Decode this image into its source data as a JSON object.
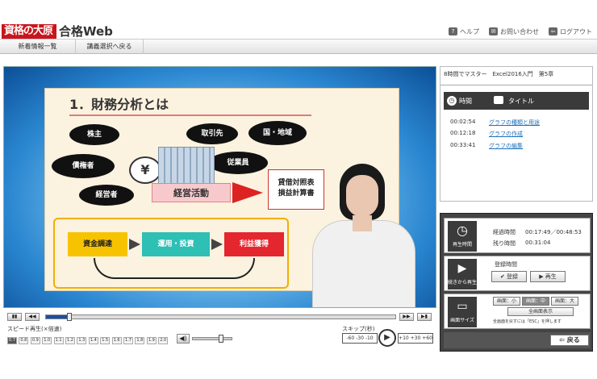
{
  "header": {
    "logo_primary": "資格の大原",
    "logo_secondary": "合格Web",
    "links": [
      {
        "icon": "help-icon",
        "label": "ヘルプ"
      },
      {
        "icon": "mail-icon",
        "label": "お問い合わせ"
      },
      {
        "icon": "logout-icon",
        "label": "ログアウト"
      }
    ]
  },
  "nav": {
    "items": [
      "新着情報一覧",
      "講義選択へ戻る"
    ]
  },
  "slide": {
    "title": "1．財務分析とは",
    "ovals": [
      "株主",
      "取引先",
      "国・地域",
      "債権者",
      "従業員",
      "経営者"
    ],
    "yen": "¥",
    "center": "経営活動",
    "doc": "貸借対照表\n損益計算書",
    "flow": [
      "資金調達",
      "運用・投資",
      "利益獲得"
    ]
  },
  "player": {
    "speed_label": "スピード再生(×倍速)",
    "speeds": [
      "0.7",
      "0.8",
      "0.9",
      "1.0",
      "1.1",
      "1.2",
      "1.3",
      "1.4",
      "1.5",
      "1.6",
      "1.7",
      "1.8",
      "1.9",
      "2.0"
    ],
    "skip_label": "スキップ(秒)",
    "skip_back": [
      "-60",
      "-30",
      "-10"
    ],
    "skip_fwd": [
      "+10",
      "+30",
      "+60"
    ],
    "progress": 0.06,
    "volume": 0.7
  },
  "course": {
    "title": "8時間でマスター　Excel2016入門　第5章",
    "col_time": "時間",
    "col_title": "タイトル",
    "chapters": [
      {
        "time": "00:02:54",
        "title": "グラフの種類と用途"
      },
      {
        "time": "00:12:18",
        "title": "グラフの作成"
      },
      {
        "time": "00:33:41",
        "title": "グラフの編集"
      }
    ]
  },
  "panel": {
    "play_time_label": "再生時間",
    "elapsed_label": "経過時間",
    "elapsed": "00:17:49／00:48:53",
    "remaining_label": "残り時間",
    "remaining": "00:31:04",
    "resume_label": "続きから再生",
    "register_label": "登録時間",
    "register_btn": "登録",
    "play_btn": "再生",
    "screen_label": "画面サイズ",
    "size_small": "画面：小",
    "size_medium": "画面：中",
    "size_large": "画面：大",
    "fullscreen": "全画面表示",
    "esc_note": "全画面を戻すには「ESC」を押します",
    "back": "戻る"
  }
}
